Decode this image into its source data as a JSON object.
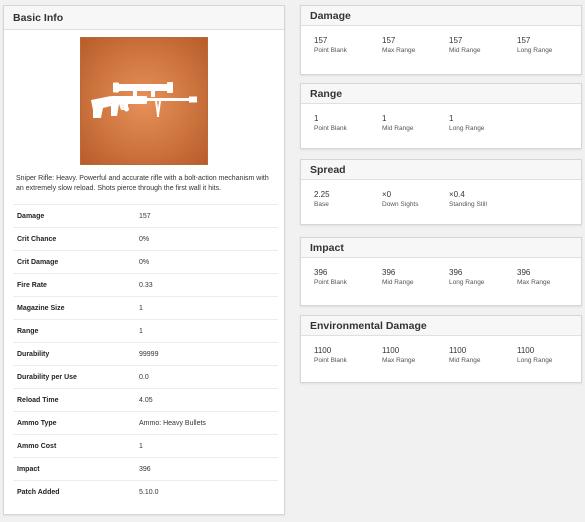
{
  "basic": {
    "title": "Basic Info",
    "description": "Sniper Rifle: Heavy. Powerful and accurate rifle with a bolt-action mechanism with an extremely slow reload. Shots pierce through the first wall it hits.",
    "stats": [
      {
        "label": "Damage",
        "value": "157"
      },
      {
        "label": "Crit Chance",
        "value": "0%"
      },
      {
        "label": "Crit Damage",
        "value": "0%"
      },
      {
        "label": "Fire Rate",
        "value": "0.33"
      },
      {
        "label": "Magazine Size",
        "value": "1"
      },
      {
        "label": "Range",
        "value": "1"
      },
      {
        "label": "Durability",
        "value": "99999"
      },
      {
        "label": "Durability per Use",
        "value": "0.0"
      },
      {
        "label": "Reload Time",
        "value": "4.05"
      },
      {
        "label": "Ammo Type",
        "value": "Ammo: Heavy Bullets"
      },
      {
        "label": "Ammo Cost",
        "value": "1"
      },
      {
        "label": "Impact",
        "value": "396"
      },
      {
        "label": "Patch Added",
        "value": "5.10.0"
      }
    ]
  },
  "damage": {
    "title": "Damage",
    "cells": [
      {
        "value": "157",
        "label": "Point Blank"
      },
      {
        "value": "157",
        "label": "Max Range"
      },
      {
        "value": "157",
        "label": "Mid Range"
      },
      {
        "value": "157",
        "label": "Long Range"
      }
    ]
  },
  "range": {
    "title": "Range",
    "cells": [
      {
        "value": "1",
        "label": "Point Blank"
      },
      {
        "value": "1",
        "label": "Mid Range"
      },
      {
        "value": "1",
        "label": "Long Range"
      }
    ]
  },
  "spread": {
    "title": "Spread",
    "cells": [
      {
        "value": "2.25",
        "label": "Base"
      },
      {
        "value": "×0",
        "label": "Down Sights"
      },
      {
        "value": "×0.4",
        "label": "Standing Still"
      }
    ]
  },
  "impact": {
    "title": "Impact",
    "cells": [
      {
        "value": "396",
        "label": "Point Blank"
      },
      {
        "value": "396",
        "label": "Mid Range"
      },
      {
        "value": "396",
        "label": "Long Range"
      },
      {
        "value": "396",
        "label": "Max Range"
      }
    ]
  },
  "env": {
    "title": "Environmental Damage",
    "cells": [
      {
        "value": "1100",
        "label": "Point Blank"
      },
      {
        "value": "1100",
        "label": "Max Range"
      },
      {
        "value": "1100",
        "label": "Mid Range"
      },
      {
        "value": "1100",
        "label": "Long Range"
      }
    ]
  },
  "colors": {
    "image_bg_center": "#e8915a",
    "image_bg_edge": "#b85d2a",
    "weapon_silhouette": "#ffffff"
  },
  "icons": {
    "weapon": "sniper-rifle-icon"
  }
}
